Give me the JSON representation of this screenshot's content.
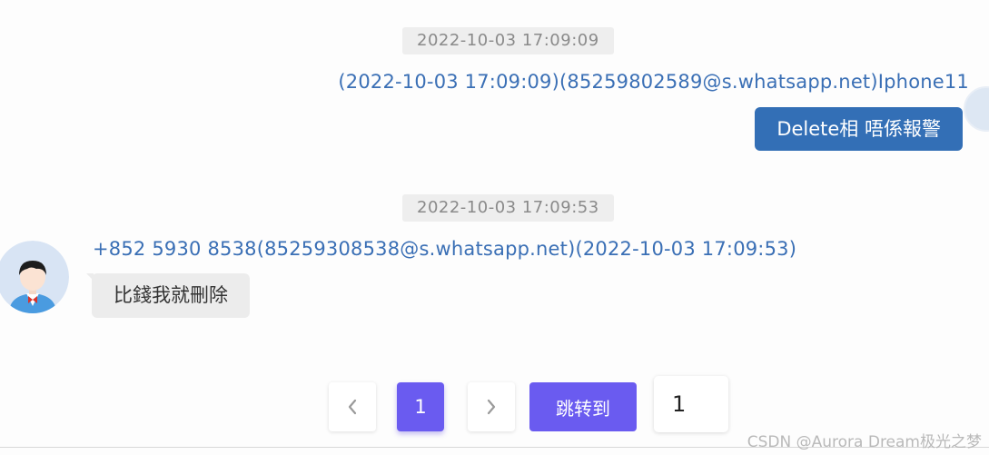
{
  "messages": [
    {
      "timestamp": "2022-10-03 17:09:09",
      "sender": "(2022-10-03 17:09:09)(85259802589@s.whatsapp.net)Iphone11",
      "text": "Delete相 唔係報警",
      "direction": "outgoing"
    },
    {
      "timestamp": "2022-10-03 17:09:53",
      "sender": "+852 5930 8538(85259308538@s.whatsapp.net)(2022-10-03 17:09:53)",
      "text": "比錢我就刪除",
      "direction": "incoming"
    }
  ],
  "pagination": {
    "prev_icon": "chevron-left-icon",
    "current_page": "1",
    "next_icon": "chevron-right-icon",
    "jump_label": "跳转到",
    "jump_value": "1"
  },
  "watermark": "CSDN @Aurora Dream极光之梦",
  "colors": {
    "accent": "#6a5bf0",
    "outgoing_bubble": "#336fb6",
    "incoming_bubble": "#ececec",
    "sender_text": "#3a6fb5"
  }
}
